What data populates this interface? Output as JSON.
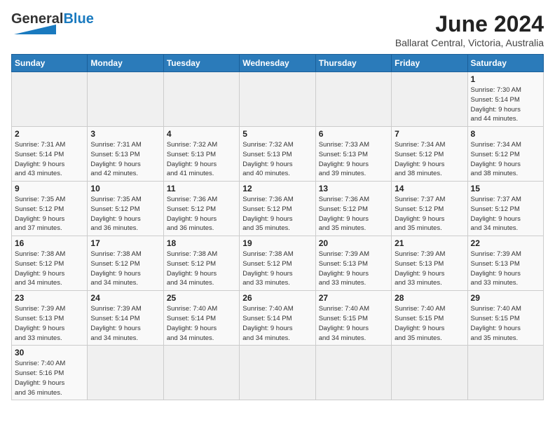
{
  "header": {
    "logo_general": "General",
    "logo_blue": "Blue",
    "month_title": "June 2024",
    "location": "Ballarat Central, Victoria, Australia"
  },
  "days_of_week": [
    "Sunday",
    "Monday",
    "Tuesday",
    "Wednesday",
    "Thursday",
    "Friday",
    "Saturday"
  ],
  "weeks": [
    [
      {
        "day": "",
        "info": ""
      },
      {
        "day": "",
        "info": ""
      },
      {
        "day": "",
        "info": ""
      },
      {
        "day": "",
        "info": ""
      },
      {
        "day": "",
        "info": ""
      },
      {
        "day": "",
        "info": ""
      },
      {
        "day": "1",
        "info": "Sunrise: 7:30 AM\nSunset: 5:14 PM\nDaylight: 9 hours\nand 44 minutes."
      }
    ],
    [
      {
        "day": "2",
        "info": "Sunrise: 7:31 AM\nSunset: 5:14 PM\nDaylight: 9 hours\nand 43 minutes."
      },
      {
        "day": "3",
        "info": "Sunrise: 7:31 AM\nSunset: 5:13 PM\nDaylight: 9 hours\nand 42 minutes."
      },
      {
        "day": "4",
        "info": "Sunrise: 7:32 AM\nSunset: 5:13 PM\nDaylight: 9 hours\nand 41 minutes."
      },
      {
        "day": "5",
        "info": "Sunrise: 7:32 AM\nSunset: 5:13 PM\nDaylight: 9 hours\nand 40 minutes."
      },
      {
        "day": "6",
        "info": "Sunrise: 7:33 AM\nSunset: 5:13 PM\nDaylight: 9 hours\nand 39 minutes."
      },
      {
        "day": "7",
        "info": "Sunrise: 7:34 AM\nSunset: 5:12 PM\nDaylight: 9 hours\nand 38 minutes."
      },
      {
        "day": "8",
        "info": "Sunrise: 7:34 AM\nSunset: 5:12 PM\nDaylight: 9 hours\nand 38 minutes."
      }
    ],
    [
      {
        "day": "9",
        "info": "Sunrise: 7:35 AM\nSunset: 5:12 PM\nDaylight: 9 hours\nand 37 minutes."
      },
      {
        "day": "10",
        "info": "Sunrise: 7:35 AM\nSunset: 5:12 PM\nDaylight: 9 hours\nand 36 minutes."
      },
      {
        "day": "11",
        "info": "Sunrise: 7:36 AM\nSunset: 5:12 PM\nDaylight: 9 hours\nand 36 minutes."
      },
      {
        "day": "12",
        "info": "Sunrise: 7:36 AM\nSunset: 5:12 PM\nDaylight: 9 hours\nand 35 minutes."
      },
      {
        "day": "13",
        "info": "Sunrise: 7:36 AM\nSunset: 5:12 PM\nDaylight: 9 hours\nand 35 minutes."
      },
      {
        "day": "14",
        "info": "Sunrise: 7:37 AM\nSunset: 5:12 PM\nDaylight: 9 hours\nand 35 minutes."
      },
      {
        "day": "15",
        "info": "Sunrise: 7:37 AM\nSunset: 5:12 PM\nDaylight: 9 hours\nand 34 minutes."
      }
    ],
    [
      {
        "day": "16",
        "info": "Sunrise: 7:38 AM\nSunset: 5:12 PM\nDaylight: 9 hours\nand 34 minutes."
      },
      {
        "day": "17",
        "info": "Sunrise: 7:38 AM\nSunset: 5:12 PM\nDaylight: 9 hours\nand 34 minutes."
      },
      {
        "day": "18",
        "info": "Sunrise: 7:38 AM\nSunset: 5:12 PM\nDaylight: 9 hours\nand 34 minutes."
      },
      {
        "day": "19",
        "info": "Sunrise: 7:38 AM\nSunset: 5:12 PM\nDaylight: 9 hours\nand 33 minutes."
      },
      {
        "day": "20",
        "info": "Sunrise: 7:39 AM\nSunset: 5:13 PM\nDaylight: 9 hours\nand 33 minutes."
      },
      {
        "day": "21",
        "info": "Sunrise: 7:39 AM\nSunset: 5:13 PM\nDaylight: 9 hours\nand 33 minutes."
      },
      {
        "day": "22",
        "info": "Sunrise: 7:39 AM\nSunset: 5:13 PM\nDaylight: 9 hours\nand 33 minutes."
      }
    ],
    [
      {
        "day": "23",
        "info": "Sunrise: 7:39 AM\nSunset: 5:13 PM\nDaylight: 9 hours\nand 33 minutes."
      },
      {
        "day": "24",
        "info": "Sunrise: 7:39 AM\nSunset: 5:14 PM\nDaylight: 9 hours\nand 34 minutes."
      },
      {
        "day": "25",
        "info": "Sunrise: 7:40 AM\nSunset: 5:14 PM\nDaylight: 9 hours\nand 34 minutes."
      },
      {
        "day": "26",
        "info": "Sunrise: 7:40 AM\nSunset: 5:14 PM\nDaylight: 9 hours\nand 34 minutes."
      },
      {
        "day": "27",
        "info": "Sunrise: 7:40 AM\nSunset: 5:15 PM\nDaylight: 9 hours\nand 34 minutes."
      },
      {
        "day": "28",
        "info": "Sunrise: 7:40 AM\nSunset: 5:15 PM\nDaylight: 9 hours\nand 35 minutes."
      },
      {
        "day": "29",
        "info": "Sunrise: 7:40 AM\nSunset: 5:15 PM\nDaylight: 9 hours\nand 35 minutes."
      }
    ],
    [
      {
        "day": "30",
        "info": "Sunrise: 7:40 AM\nSunset: 5:16 PM\nDaylight: 9 hours\nand 36 minutes."
      },
      {
        "day": "",
        "info": ""
      },
      {
        "day": "",
        "info": ""
      },
      {
        "day": "",
        "info": ""
      },
      {
        "day": "",
        "info": ""
      },
      {
        "day": "",
        "info": ""
      },
      {
        "day": "",
        "info": ""
      }
    ]
  ]
}
